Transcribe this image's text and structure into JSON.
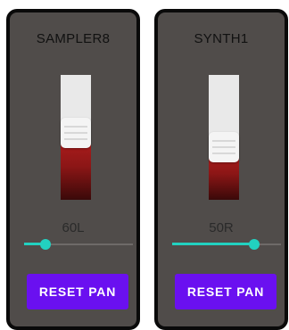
{
  "reset_label": "RESET PAN",
  "channels": [
    {
      "name": "SAMPLER8",
      "pan_label": "60L",
      "volume": 0.55,
      "pan": -0.6
    },
    {
      "name": "SYNTH1",
      "pan_label": "50R",
      "volume": 0.4,
      "pan": 0.5
    }
  ],
  "colors": {
    "panel": "#504c4a",
    "border": "#0a0a0a",
    "fader_fill": "#b51e1e",
    "slider_accent": "#22d1c0",
    "button": "#6a10f0"
  }
}
